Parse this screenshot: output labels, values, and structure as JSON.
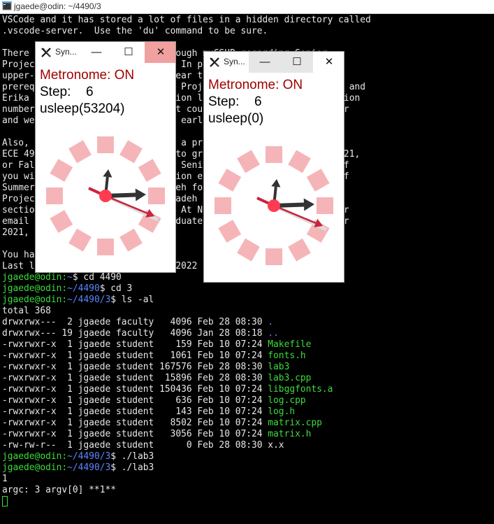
{
  "window_title": "jgaede@odin: ~/4490/3",
  "terminal": {
    "lines": [
      {
        "s": [
          {
            "t": "VSCode and it has stored a lot of files in a hidden directory called",
            "c": "w"
          }
        ]
      },
      {
        "s": [
          {
            "t": ".vscode-server.  Use the 'du' command to be sure.",
            "c": "w"
          }
        ]
      },
      {
        "s": [
          {
            "t": "",
            "c": "w"
          }
        ]
      },
      {
        "s": [
          {
            "t": "There is also the email sent through myCSUB regarding Senior",
            "c": "w"
          }
        ]
      },
      {
        "s": [
          {
            "t": "Project (CMPS 4910 or ECE 4910). In particular you need 12",
            "c": "w"
          }
        ]
      },
      {
        "s": [
          {
            "t": "upper-division units and to be near the end of study to get a",
            "c": "w"
          }
        ]
      },
      {
        "s": [
          {
            "t": "prerequisite override for Senior Project by Dr. Nick Tafarzadeh and",
            "c": "w"
          }
        ]
      },
      {
        "s": [
          {
            "t": "Erika Montanez. Provide information like your name and the section",
            "c": "w"
          }
        ]
      },
      {
        "s": [
          {
            "t": "number of the course you want. It could be the next semester for",
            "c": "w"
          }
        ]
      },
      {
        "s": [
          {
            "t": "and we send reminders... usually early each semester.",
            "c": "w"
          }
        ]
      },
      {
        "s": [
          {
            "t": "",
            "c": "w"
          }
        ]
      },
      {
        "s": [
          {
            "t": "Also, if you are planning to run a project through CMPS 4910 or",
            "c": "w"
          }
        ]
      },
      {
        "s": [
          {
            "t": "ECE 4910 in Spring and you want to graduate in Spring/Summer 2021,",
            "c": "w"
          }
        ]
      },
      {
        "s": [
          {
            "t": "or Fall 2021, please sign up for Senior Project in Fall 2020. If",
            "c": "w"
          }
        ]
      },
      {
        "s": [
          {
            "t": "you wish to get a project extension early, wait until the end of",
            "c": "w"
          }
        ]
      },
      {
        "s": [
          {
            "t": "Summer and contact Nick Tafarzadeh for a project in Also Senior",
            "c": "w"
          }
        ]
      },
      {
        "s": [
          {
            "t": "Project, by emailing Nick Tafarzadeh for something in the",
            "c": "w"
          }
        ]
      },
      {
        "s": [
          {
            "t": "section. Please send it to Nick. At Nick's email, and cc to your",
            "c": "w"
          }
        ]
      },
      {
        "s": [
          {
            "t": "email about when you plan to graduate, for example Spring/Summer",
            "c": "w"
          }
        ]
      },
      {
        "s": [
          {
            "t": "2021,",
            "c": "w"
          }
        ]
      },
      {
        "s": [
          {
            "t": "",
            "c": "w"
          }
        ]
      },
      {
        "s": [
          {
            "t": "You have mail.",
            "c": "w"
          }
        ]
      },
      {
        "s": [
          {
            "t": "Last login: Mon Feb 28 08:09:47 2022 from 10.0.0.1",
            "c": "w"
          }
        ]
      },
      {
        "s": [
          {
            "t": "jgaede@odin:",
            "c": "g"
          },
          {
            "t": "~",
            "c": "b"
          },
          {
            "t": "$ cd 4490",
            "c": "w"
          }
        ]
      },
      {
        "s": [
          {
            "t": "jgaede@odin:",
            "c": "g"
          },
          {
            "t": "~/4490",
            "c": "b"
          },
          {
            "t": "$ cd 3",
            "c": "w"
          }
        ]
      },
      {
        "s": [
          {
            "t": "jgaede@odin:",
            "c": "g"
          },
          {
            "t": "~/4490/3",
            "c": "b"
          },
          {
            "t": "$ ls -al",
            "c": "w"
          }
        ]
      },
      {
        "s": [
          {
            "t": "total 368",
            "c": "w"
          }
        ]
      },
      {
        "s": [
          {
            "t": "drwxrwx---  2 jgaede faculty   4096 Feb 28 08:30 ",
            "c": "w"
          },
          {
            "t": ".",
            "c": "b"
          }
        ]
      },
      {
        "s": [
          {
            "t": "drwxrwx--- 19 jgaede faculty   4096 Jan 28 08:18 ",
            "c": "w"
          },
          {
            "t": "..",
            "c": "b"
          }
        ]
      },
      {
        "s": [
          {
            "t": "-rwxrwxr-x  1 jgaede student    159 Feb 10 07:24 ",
            "c": "w"
          },
          {
            "t": "Makefile",
            "c": "g"
          }
        ]
      },
      {
        "s": [
          {
            "t": "-rwxrwxr-x  1 jgaede student   1061 Feb 10 07:24 ",
            "c": "w"
          },
          {
            "t": "fonts.h",
            "c": "g"
          }
        ]
      },
      {
        "s": [
          {
            "t": "-rwxrwxr-x  1 jgaede student 167576 Feb 28 08:30 ",
            "c": "w"
          },
          {
            "t": "lab3",
            "c": "g"
          }
        ]
      },
      {
        "s": [
          {
            "t": "-rwxrwxr-x  1 jgaede student  15896 Feb 28 08:30 ",
            "c": "w"
          },
          {
            "t": "lab3.cpp",
            "c": "g"
          }
        ]
      },
      {
        "s": [
          {
            "t": "-rwxrwxr-x  1 jgaede student 150436 Feb 10 07:24 ",
            "c": "w"
          },
          {
            "t": "libggfonts.a",
            "c": "g"
          }
        ]
      },
      {
        "s": [
          {
            "t": "-rwxrwxr-x  1 jgaede student    636 Feb 10 07:24 ",
            "c": "w"
          },
          {
            "t": "log.cpp",
            "c": "g"
          }
        ]
      },
      {
        "s": [
          {
            "t": "-rwxrwxr-x  1 jgaede student    143 Feb 10 07:24 ",
            "c": "w"
          },
          {
            "t": "log.h",
            "c": "g"
          }
        ]
      },
      {
        "s": [
          {
            "t": "-rwxrwxr-x  1 jgaede student   8502 Feb 10 07:24 ",
            "c": "w"
          },
          {
            "t": "matrix.cpp",
            "c": "g"
          }
        ]
      },
      {
        "s": [
          {
            "t": "-rwxrwxr-x  1 jgaede student   3056 Feb 10 07:24 ",
            "c": "w"
          },
          {
            "t": "matrix.h",
            "c": "g"
          }
        ]
      },
      {
        "s": [
          {
            "t": "-rw-rw-r--  1 jgaede student      0 Feb 28 08:30 x.x",
            "c": "w"
          }
        ]
      },
      {
        "s": [
          {
            "t": "jgaede@odin:",
            "c": "g"
          },
          {
            "t": "~/4490/3",
            "c": "b"
          },
          {
            "t": "$ ./lab3",
            "c": "w"
          }
        ]
      },
      {
        "s": [
          {
            "t": "jgaede@odin:",
            "c": "g"
          },
          {
            "t": "~/4490/3",
            "c": "b"
          },
          {
            "t": "$ ./lab3",
            "c": "w"
          }
        ]
      },
      {
        "s": [
          {
            "t": "1",
            "c": "w"
          }
        ]
      },
      {
        "s": [
          {
            "t": "argc: 3 argv[0] **1**",
            "c": "w"
          }
        ]
      }
    ]
  },
  "windows": [
    {
      "title": "Syn...",
      "metronome": "Metronome: ON",
      "step_label": "Step:",
      "step_value": "6",
      "usleep": "usleep(53204)",
      "min_glyph": "—",
      "max_glyph": "☐",
      "close_glyph": "✕",
      "close_hot": true,
      "minmax_hot": false
    },
    {
      "title": "Syn...",
      "metronome": "Metronome: ON",
      "step_label": "Step:",
      "step_value": "6",
      "usleep": "usleep(0)",
      "min_glyph": "—",
      "max_glyph": "☐",
      "close_glyph": "✕",
      "close_hot": false,
      "minmax_hot": true
    }
  ],
  "colors": {
    "prompt_green": "#3ddc3d",
    "path_blue": "#5a86ff",
    "metronome_red": "#a00000",
    "dial_square": "#f5b5b8",
    "center_dot": "#ff3b52",
    "hand_dark": "#333333",
    "hand_red": "#c8243c"
  }
}
